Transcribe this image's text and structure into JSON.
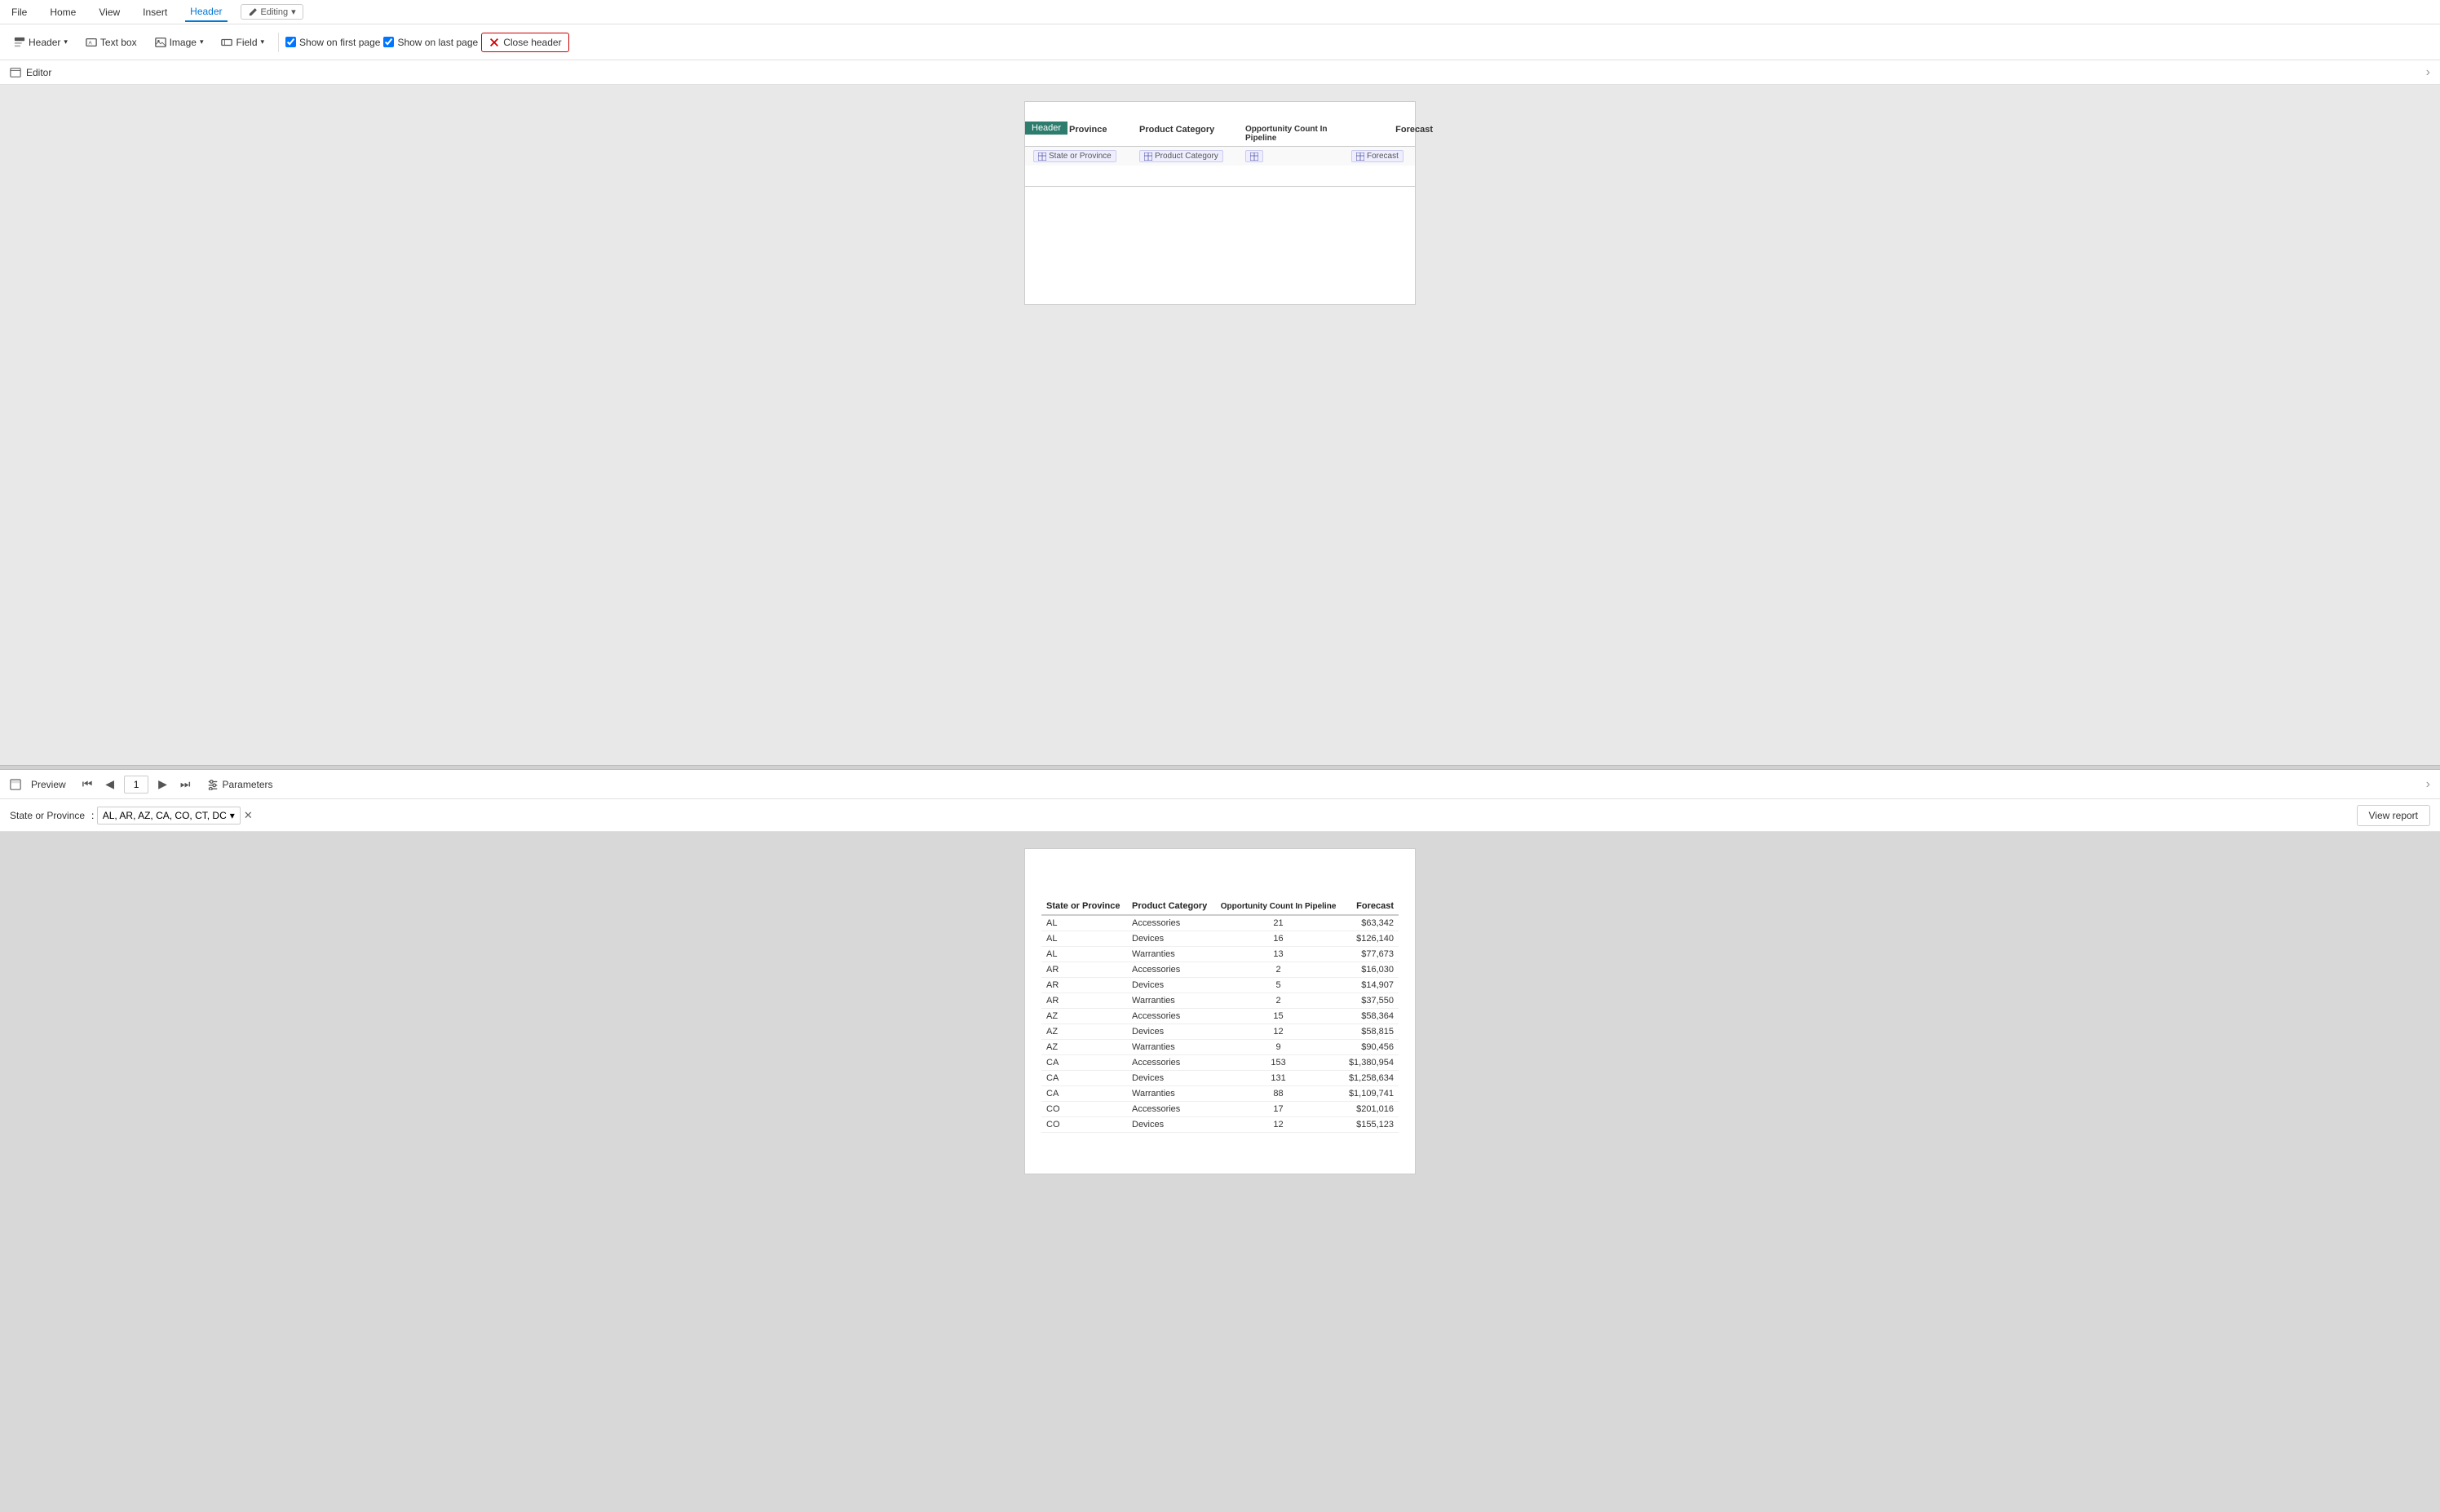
{
  "menubar": {
    "items": [
      "File",
      "Home",
      "View",
      "Insert",
      "Header"
    ],
    "active": "Header",
    "editing_label": "Editing"
  },
  "toolbar": {
    "header_label": "Header",
    "textbox_label": "Text box",
    "image_label": "Image",
    "field_label": "Field",
    "show_first_page_label": "Show on first page",
    "show_last_page_label": "Show on last page",
    "close_header_label": "Close header",
    "show_first_checked": true,
    "show_last_checked": true
  },
  "editor": {
    "label": "Editor",
    "header_tag": "Header",
    "columns": [
      {
        "label": "State or Province"
      },
      {
        "label": "Product Category"
      },
      {
        "label": "Opportunity Count In Pipeline"
      },
      {
        "label": "Forecast"
      }
    ],
    "fields": [
      {
        "icon": "table-icon",
        "label": "State or Province"
      },
      {
        "icon": "table-icon",
        "label": "Product Category"
      },
      {
        "icon": "table-icon",
        "label": ""
      },
      {
        "icon": "table-icon",
        "label": "Forecast"
      }
    ]
  },
  "preview": {
    "label": "Preview",
    "current_page": "1",
    "parameters_label": "Parameters"
  },
  "params": {
    "label": "State or Province",
    "value": "AL, AR, AZ, CA, CO, CT, DC",
    "view_report_label": "View report"
  },
  "table": {
    "columns": [
      {
        "label": "State or Province",
        "align": "left"
      },
      {
        "label": "Product Category",
        "align": "left"
      },
      {
        "label": "Opportunity Count In Pipeline",
        "align": "center"
      },
      {
        "label": "Forecast",
        "align": "right"
      }
    ],
    "rows": [
      {
        "state": "AL",
        "category": "Accessories",
        "count": "21",
        "forecast": "$63,342"
      },
      {
        "state": "AL",
        "category": "Devices",
        "count": "16",
        "forecast": "$126,140"
      },
      {
        "state": "AL",
        "category": "Warranties",
        "count": "13",
        "forecast": "$77,673"
      },
      {
        "state": "AR",
        "category": "Accessories",
        "count": "2",
        "forecast": "$16,030"
      },
      {
        "state": "AR",
        "category": "Devices",
        "count": "5",
        "forecast": "$14,907"
      },
      {
        "state": "AR",
        "category": "Warranties",
        "count": "2",
        "forecast": "$37,550"
      },
      {
        "state": "AZ",
        "category": "Accessories",
        "count": "15",
        "forecast": "$58,364"
      },
      {
        "state": "AZ",
        "category": "Devices",
        "count": "12",
        "forecast": "$58,815"
      },
      {
        "state": "AZ",
        "category": "Warranties",
        "count": "9",
        "forecast": "$90,456"
      },
      {
        "state": "CA",
        "category": "Accessories",
        "count": "153",
        "forecast": "$1,380,954"
      },
      {
        "state": "CA",
        "category": "Devices",
        "count": "131",
        "forecast": "$1,258,634"
      },
      {
        "state": "CA",
        "category": "Warranties",
        "count": "88",
        "forecast": "$1,109,741"
      },
      {
        "state": "CO",
        "category": "Accessories",
        "count": "17",
        "forecast": "$201,016"
      },
      {
        "state": "CO",
        "category": "Devices",
        "count": "12",
        "forecast": "$155,123"
      }
    ]
  },
  "colors": {
    "header_tab_underline": "#0078d4",
    "header_tag_bg": "#2d7d6f",
    "close_header_border": "#cc0000"
  }
}
